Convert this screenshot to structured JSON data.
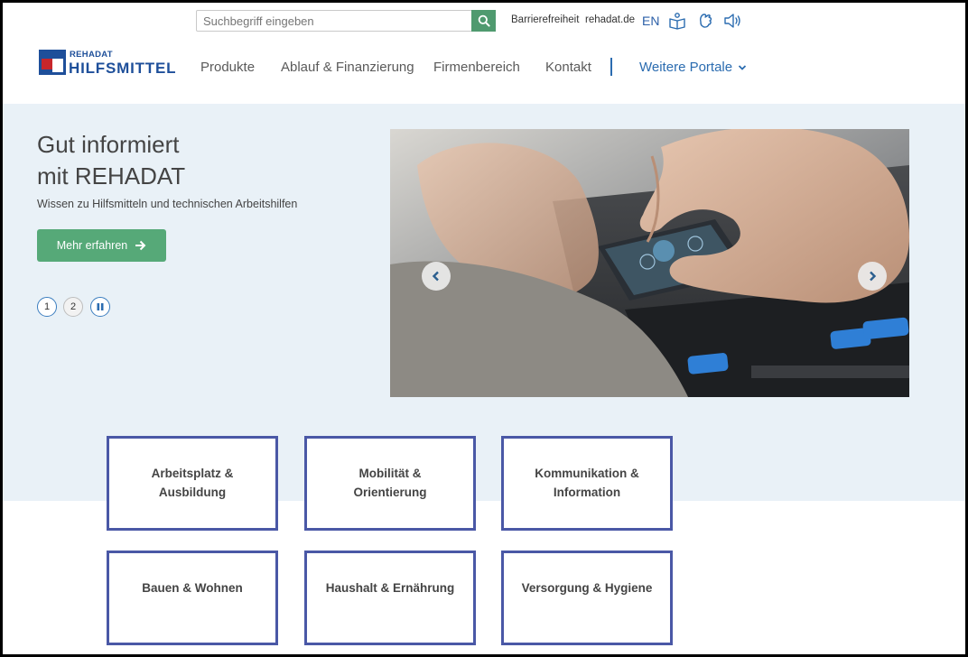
{
  "search": {
    "placeholder": "Suchbegriff eingeben"
  },
  "utility": {
    "accessibility": "Barrierefreiheit",
    "site": "rehadat.de",
    "language": "EN"
  },
  "logo": {
    "small": "REHADAT",
    "big": "HILFSMITTEL"
  },
  "nav": {
    "items": [
      {
        "label": "Produkte"
      },
      {
        "label": "Ablauf & Finanzierung"
      },
      {
        "label": "Firmenbereich"
      },
      {
        "label": "Kontakt"
      }
    ],
    "more": "Weitere Portale"
  },
  "hero": {
    "title_line1": "Gut informiert",
    "title_line2": "mit REHADAT",
    "subtitle": "Wissen zu Hilfsmitteln und technischen Arbeitshilfen",
    "cta": "Mehr erfahren",
    "slides": [
      "1",
      "2"
    ]
  },
  "categories": [
    {
      "label": "Arbeitsplatz &\nAusbildung"
    },
    {
      "label": "Mobilität &\nOrientierung"
    },
    {
      "label": "Kommunikation &\nInformation"
    },
    {
      "label": "Bauen & Wohnen"
    },
    {
      "label": "Haushalt & Ernährung"
    },
    {
      "label": "Versorgung & Hygiene"
    }
  ],
  "colors": {
    "brand_blue": "#1e4f9a",
    "accent_green": "#56a978",
    "tile_border": "#4a58a6",
    "hero_bg": "#e9f1f7"
  }
}
